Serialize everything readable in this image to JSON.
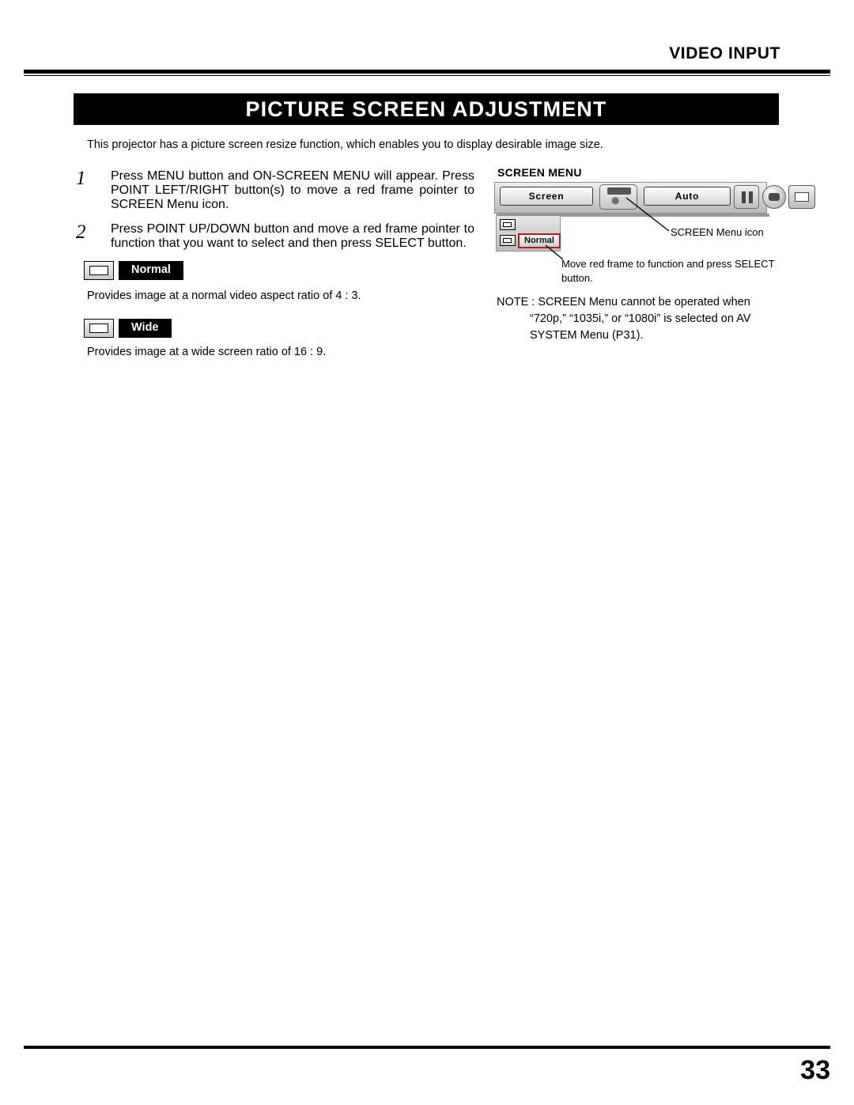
{
  "header": {
    "section_title": "VIDEO INPUT"
  },
  "banner": {
    "title": "PICTURE SCREEN ADJUSTMENT"
  },
  "intro": "This projector has a picture screen resize function, which enables you to display desirable image size.",
  "steps": [
    {
      "number": "1",
      "text": "Press MENU button and ON-SCREEN MENU will appear.  Press POINT LEFT/RIGHT button(s) to move a red frame pointer to SCREEN Menu icon."
    },
    {
      "number": "2",
      "text": "Press POINT UP/DOWN button and move a red frame pointer to function that you want to select and then press SELECT button."
    }
  ],
  "functions": [
    {
      "label": "Normal",
      "description": "Provides image at a normal video aspect ratio of 4 : 3."
    },
    {
      "label": "Wide",
      "description": "Provides image at a wide screen ratio of 16 : 9."
    }
  ],
  "screen_menu": {
    "heading": "SCREEN MENU",
    "osd": {
      "tab_label": "Screen",
      "auto_label": "Auto",
      "selected_item": "Normal"
    },
    "callouts": [
      "SCREEN Menu icon",
      "Move red frame to function and press SELECT button."
    ],
    "note": {
      "line1": "NOTE : SCREEN Menu cannot be operated when",
      "line2": "“720p,” “1035i,” or “1080i” is selected on AV",
      "line3": "SYSTEM Menu (P31)."
    }
  },
  "footer": {
    "page_number": "33"
  },
  "colors": {
    "accent_red": "#c11818",
    "banner_bg": "#000000",
    "text": "#000000"
  }
}
